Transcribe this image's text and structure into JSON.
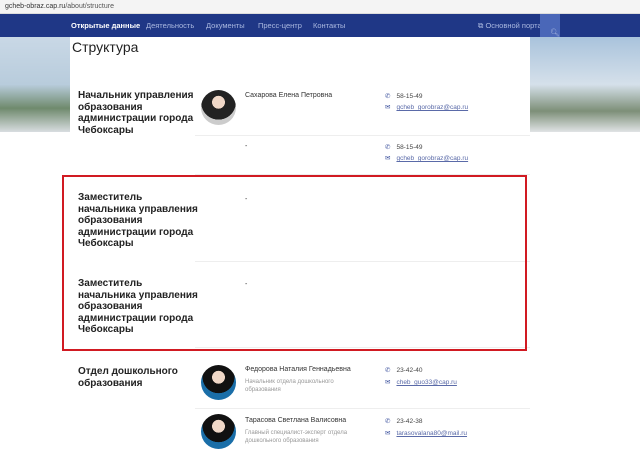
{
  "address_bar": {
    "host": "gcheb-obraz.cap.ru",
    "path": "/about/structure"
  },
  "nav": {
    "items": [
      "Открытые данные",
      "Деятельность",
      "Документы",
      "Пресс-центр",
      "Контакты"
    ],
    "portal": "Основной портал",
    "accent": "#1f3786"
  },
  "page_title": "Структура",
  "sections": [
    {
      "title": "Начальник управления образования администрации города Чебоксары",
      "people": [
        {
          "name": "Сахарова Елена Петровна",
          "position": "",
          "phone": "58-15-49",
          "email": "gcheb_gorobraz@cap.ru"
        },
        {
          "name": "-",
          "position": "",
          "phone": "58-15-49",
          "email": "gcheb_gorobraz@cap.ru"
        }
      ]
    },
    {
      "title": "Заместитель начальника управления образования администрации города Чебоксары",
      "people": [
        {
          "name": "-"
        }
      ]
    },
    {
      "title": "Заместитель начальника управления образования администрации города Чебоксары",
      "people": [
        {
          "name": "-"
        }
      ]
    },
    {
      "title": "Отдел дошкольного образования",
      "people": [
        {
          "name": "Федорова Наталия Геннадьевна",
          "position": "Начальник отдела дошкольного образования",
          "phone": "23-42-40",
          "email": "cheb_guo33@cap.ru"
        },
        {
          "name": "Тарасова Светлана Валисовна",
          "position": "Главный специалист-эксперт отдела дошкольного образования",
          "phone": "23-42-38",
          "email": "tarasovalana80@mail.ru"
        }
      ]
    }
  ],
  "highlight_color": "#d11a22"
}
